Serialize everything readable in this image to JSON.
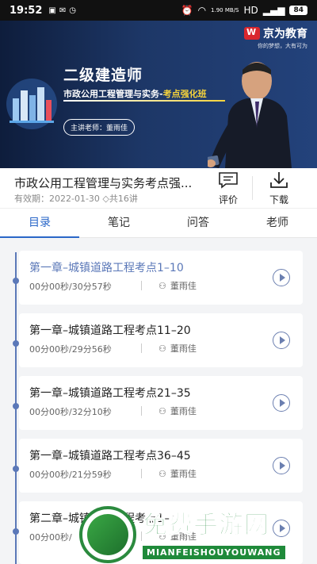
{
  "status_bar": {
    "time": "19:52",
    "net_speed": "1.90 MB/S",
    "network": "HD",
    "battery": "84"
  },
  "video": {
    "brand_name": "京为教育",
    "brand_slogan": "你的梦想，大有可为",
    "title": "二级建造师",
    "subtitle_main": "市政公用工程管理与实务-",
    "subtitle_highlight": "考点强化班",
    "teacher_label": "主讲老师：董雨佳"
  },
  "course": {
    "title": "市政公用工程管理与实务考点强...",
    "meta": "有效期：2022-01-30  ◇共16讲",
    "actions": {
      "evaluate": "评价",
      "download": "下载"
    }
  },
  "tabs": [
    {
      "label": "目录",
      "active": true
    },
    {
      "label": "笔记",
      "active": false
    },
    {
      "label": "问答",
      "active": false
    },
    {
      "label": "老师",
      "active": false
    }
  ],
  "lessons": [
    {
      "title": "第一章–城镇道路工程考点1–10",
      "progress": "00分00秒/30分57秒",
      "teacher": "董雨佳",
      "current": true
    },
    {
      "title": "第一章–城镇道路工程考点11–20",
      "progress": "00分00秒/29分56秒",
      "teacher": "董雨佳",
      "current": false
    },
    {
      "title": "第一章–城镇道路工程考点21–35",
      "progress": "00分00秒/32分10秒",
      "teacher": "董雨佳",
      "current": false
    },
    {
      "title": "第一章–城镇道路工程考点36–45",
      "progress": "00分00秒/21分59秒",
      "teacher": "董雨佳",
      "current": false
    },
    {
      "title": "第二章–城镇桥梁工程考点1–10",
      "progress": "00分00秒/",
      "teacher": "董雨佳",
      "current": false
    }
  ],
  "watermark": {
    "text": "免费手游网",
    "sub": "MIANFEISHOUYOUWANG"
  },
  "colors": {
    "accent": "#2a67c8",
    "timeline": "#5b78b8",
    "highlight": "#f5d33c"
  }
}
